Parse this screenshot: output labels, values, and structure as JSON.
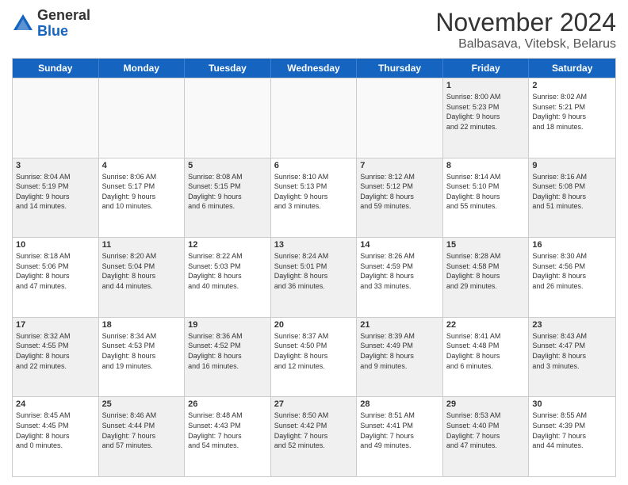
{
  "header": {
    "logo_general": "General",
    "logo_blue": "Blue",
    "month_title": "November 2024",
    "location": "Balbasava, Vitebsk, Belarus"
  },
  "weekdays": [
    "Sunday",
    "Monday",
    "Tuesday",
    "Wednesday",
    "Thursday",
    "Friday",
    "Saturday"
  ],
  "rows": [
    [
      {
        "day": "",
        "info": "",
        "empty": true
      },
      {
        "day": "",
        "info": "",
        "empty": true
      },
      {
        "day": "",
        "info": "",
        "empty": true
      },
      {
        "day": "",
        "info": "",
        "empty": true
      },
      {
        "day": "",
        "info": "",
        "empty": true
      },
      {
        "day": "1",
        "info": "Sunrise: 8:00 AM\nSunset: 5:23 PM\nDaylight: 9 hours\nand 22 minutes.",
        "shaded": true
      },
      {
        "day": "2",
        "info": "Sunrise: 8:02 AM\nSunset: 5:21 PM\nDaylight: 9 hours\nand 18 minutes.",
        "shaded": false
      }
    ],
    [
      {
        "day": "3",
        "info": "Sunrise: 8:04 AM\nSunset: 5:19 PM\nDaylight: 9 hours\nand 14 minutes.",
        "shaded": true
      },
      {
        "day": "4",
        "info": "Sunrise: 8:06 AM\nSunset: 5:17 PM\nDaylight: 9 hours\nand 10 minutes.",
        "shaded": false
      },
      {
        "day": "5",
        "info": "Sunrise: 8:08 AM\nSunset: 5:15 PM\nDaylight: 9 hours\nand 6 minutes.",
        "shaded": true
      },
      {
        "day": "6",
        "info": "Sunrise: 8:10 AM\nSunset: 5:13 PM\nDaylight: 9 hours\nand 3 minutes.",
        "shaded": false
      },
      {
        "day": "7",
        "info": "Sunrise: 8:12 AM\nSunset: 5:12 PM\nDaylight: 8 hours\nand 59 minutes.",
        "shaded": true
      },
      {
        "day": "8",
        "info": "Sunrise: 8:14 AM\nSunset: 5:10 PM\nDaylight: 8 hours\nand 55 minutes.",
        "shaded": false
      },
      {
        "day": "9",
        "info": "Sunrise: 8:16 AM\nSunset: 5:08 PM\nDaylight: 8 hours\nand 51 minutes.",
        "shaded": true
      }
    ],
    [
      {
        "day": "10",
        "info": "Sunrise: 8:18 AM\nSunset: 5:06 PM\nDaylight: 8 hours\nand 47 minutes.",
        "shaded": false
      },
      {
        "day": "11",
        "info": "Sunrise: 8:20 AM\nSunset: 5:04 PM\nDaylight: 8 hours\nand 44 minutes.",
        "shaded": true
      },
      {
        "day": "12",
        "info": "Sunrise: 8:22 AM\nSunset: 5:03 PM\nDaylight: 8 hours\nand 40 minutes.",
        "shaded": false
      },
      {
        "day": "13",
        "info": "Sunrise: 8:24 AM\nSunset: 5:01 PM\nDaylight: 8 hours\nand 36 minutes.",
        "shaded": true
      },
      {
        "day": "14",
        "info": "Sunrise: 8:26 AM\nSunset: 4:59 PM\nDaylight: 8 hours\nand 33 minutes.",
        "shaded": false
      },
      {
        "day": "15",
        "info": "Sunrise: 8:28 AM\nSunset: 4:58 PM\nDaylight: 8 hours\nand 29 minutes.",
        "shaded": true
      },
      {
        "day": "16",
        "info": "Sunrise: 8:30 AM\nSunset: 4:56 PM\nDaylight: 8 hours\nand 26 minutes.",
        "shaded": false
      }
    ],
    [
      {
        "day": "17",
        "info": "Sunrise: 8:32 AM\nSunset: 4:55 PM\nDaylight: 8 hours\nand 22 minutes.",
        "shaded": true
      },
      {
        "day": "18",
        "info": "Sunrise: 8:34 AM\nSunset: 4:53 PM\nDaylight: 8 hours\nand 19 minutes.",
        "shaded": false
      },
      {
        "day": "19",
        "info": "Sunrise: 8:36 AM\nSunset: 4:52 PM\nDaylight: 8 hours\nand 16 minutes.",
        "shaded": true
      },
      {
        "day": "20",
        "info": "Sunrise: 8:37 AM\nSunset: 4:50 PM\nDaylight: 8 hours\nand 12 minutes.",
        "shaded": false
      },
      {
        "day": "21",
        "info": "Sunrise: 8:39 AM\nSunset: 4:49 PM\nDaylight: 8 hours\nand 9 minutes.",
        "shaded": true
      },
      {
        "day": "22",
        "info": "Sunrise: 8:41 AM\nSunset: 4:48 PM\nDaylight: 8 hours\nand 6 minutes.",
        "shaded": false
      },
      {
        "day": "23",
        "info": "Sunrise: 8:43 AM\nSunset: 4:47 PM\nDaylight: 8 hours\nand 3 minutes.",
        "shaded": true
      }
    ],
    [
      {
        "day": "24",
        "info": "Sunrise: 8:45 AM\nSunset: 4:45 PM\nDaylight: 8 hours\nand 0 minutes.",
        "shaded": false
      },
      {
        "day": "25",
        "info": "Sunrise: 8:46 AM\nSunset: 4:44 PM\nDaylight: 7 hours\nand 57 minutes.",
        "shaded": true
      },
      {
        "day": "26",
        "info": "Sunrise: 8:48 AM\nSunset: 4:43 PM\nDaylight: 7 hours\nand 54 minutes.",
        "shaded": false
      },
      {
        "day": "27",
        "info": "Sunrise: 8:50 AM\nSunset: 4:42 PM\nDaylight: 7 hours\nand 52 minutes.",
        "shaded": true
      },
      {
        "day": "28",
        "info": "Sunrise: 8:51 AM\nSunset: 4:41 PM\nDaylight: 7 hours\nand 49 minutes.",
        "shaded": false
      },
      {
        "day": "29",
        "info": "Sunrise: 8:53 AM\nSunset: 4:40 PM\nDaylight: 7 hours\nand 47 minutes.",
        "shaded": true
      },
      {
        "day": "30",
        "info": "Sunrise: 8:55 AM\nSunset: 4:39 PM\nDaylight: 7 hours\nand 44 minutes.",
        "shaded": false
      }
    ]
  ]
}
